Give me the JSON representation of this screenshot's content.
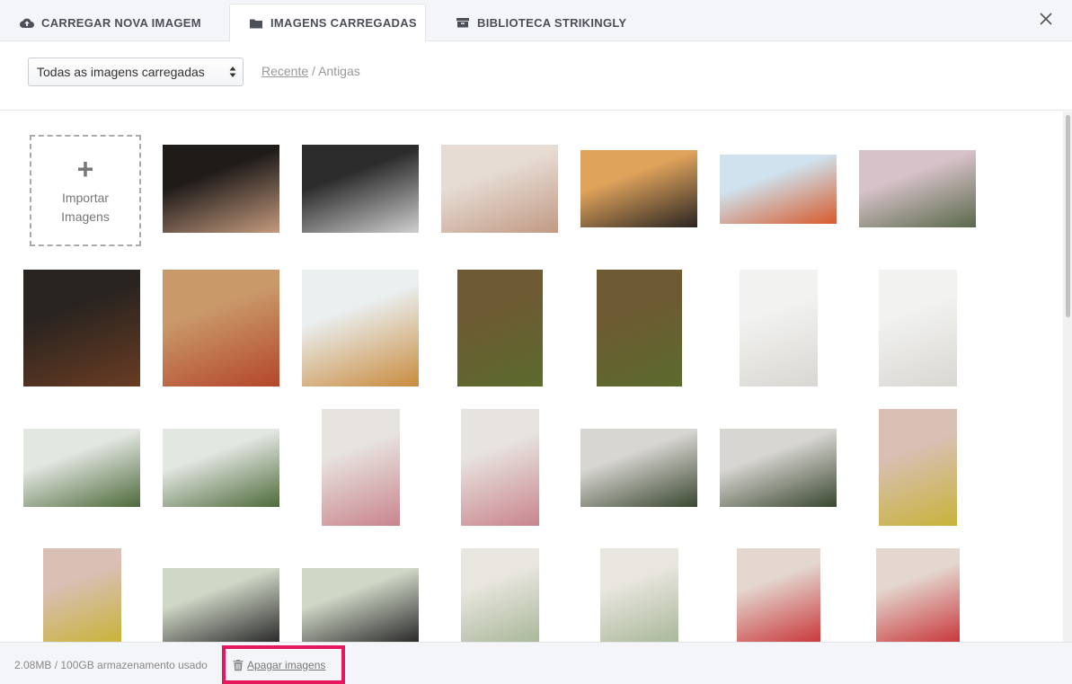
{
  "tabs": [
    {
      "label": "CARREGAR NOVA IMAGEM",
      "icon": "cloud-upload-icon"
    },
    {
      "label": "IMAGENS CARREGADAS",
      "icon": "folder-icon"
    },
    {
      "label": "BIBLIOTECA STRIKINGLY",
      "icon": "archive-icon"
    }
  ],
  "filter": {
    "selected": "Todas as imagens carregadas",
    "sort_recent": "Recente",
    "sort_separator": " / ",
    "sort_old": "Antigas"
  },
  "import": {
    "line1": "Importar",
    "line2": "Imagens"
  },
  "images": [
    {
      "subject": "painted nails",
      "colors": [
        "#1f1b19",
        "#c49a7e"
      ]
    },
    {
      "subject": "manicure tools",
      "colors": [
        "#2c2c2c",
        "#cfcfcf"
      ]
    },
    {
      "subject": "nail salon",
      "colors": [
        "#e6dcd4",
        "#c29a84"
      ]
    },
    {
      "subject": "man at sunset mountains",
      "colors": [
        "#e0a35c",
        "#2a2522"
      ]
    },
    {
      "subject": "woman with scarf",
      "colors": [
        "#cfe2ee",
        "#d75a2c"
      ]
    },
    {
      "subject": "jump in mountains",
      "colors": [
        "#d7c2c9",
        "#59694a"
      ]
    },
    {
      "subject": "chocolate pieces",
      "colors": [
        "#2a2420",
        "#6a3c22"
      ]
    },
    {
      "subject": "pizza on board",
      "colors": [
        "#c9996a",
        "#b4462a"
      ]
    },
    {
      "subject": "cupcakes",
      "colors": [
        "#eaeff0",
        "#c98b3e"
      ]
    },
    {
      "subject": "girl with swans",
      "colors": [
        "#6e5a33",
        "#5b6b2d"
      ]
    },
    {
      "subject": "girl with swans",
      "colors": [
        "#6e5a33",
        "#5b6b2d"
      ]
    },
    {
      "subject": "white interior",
      "colors": [
        "#f2f2f0",
        "#d9d7d2"
      ]
    },
    {
      "subject": "white interior",
      "colors": [
        "#f2f2f0",
        "#d9d7d2"
      ]
    },
    {
      "subject": "woman at lake",
      "colors": [
        "#e3e7e2",
        "#4d6a3a"
      ]
    },
    {
      "subject": "woman at lake",
      "colors": [
        "#e3e7e2",
        "#4d6a3a"
      ]
    },
    {
      "subject": "tulips in vase",
      "colors": [
        "#e7e3df",
        "#c9848d"
      ]
    },
    {
      "subject": "tulips in vase",
      "colors": [
        "#e7e3df",
        "#c9848d"
      ]
    },
    {
      "subject": "plants and sofa",
      "colors": [
        "#d8d6d2",
        "#39472f"
      ]
    },
    {
      "subject": "plants and sofa",
      "colors": [
        "#d8d6d2",
        "#39472f"
      ]
    },
    {
      "subject": "pink dress with flowers",
      "colors": [
        "#d9bfb4",
        "#c8b33a"
      ]
    },
    {
      "subject": "pink dress with flowers",
      "colors": [
        "#d9bfb4",
        "#c8b33a"
      ]
    },
    {
      "subject": "girl in field",
      "colors": [
        "#cfd7c6",
        "#2a2a2a"
      ]
    },
    {
      "subject": "girl in field",
      "colors": [
        "#cfd7c6",
        "#2a2a2a"
      ]
    },
    {
      "subject": "living room sofa",
      "colors": [
        "#e9e6df",
        "#a9b89a"
      ]
    },
    {
      "subject": "living room sofa",
      "colors": [
        "#e9e6df",
        "#a9b89a"
      ]
    },
    {
      "subject": "picnic with drink jar",
      "colors": [
        "#e4d7cf",
        "#c9383b"
      ]
    },
    {
      "subject": "picnic with drink jar",
      "colors": [
        "#e4d7cf",
        "#c9383b"
      ]
    }
  ],
  "footer": {
    "usage": "2.08MB / 100GB armazenamento usado",
    "delete_label": "Apagar imagens"
  }
}
